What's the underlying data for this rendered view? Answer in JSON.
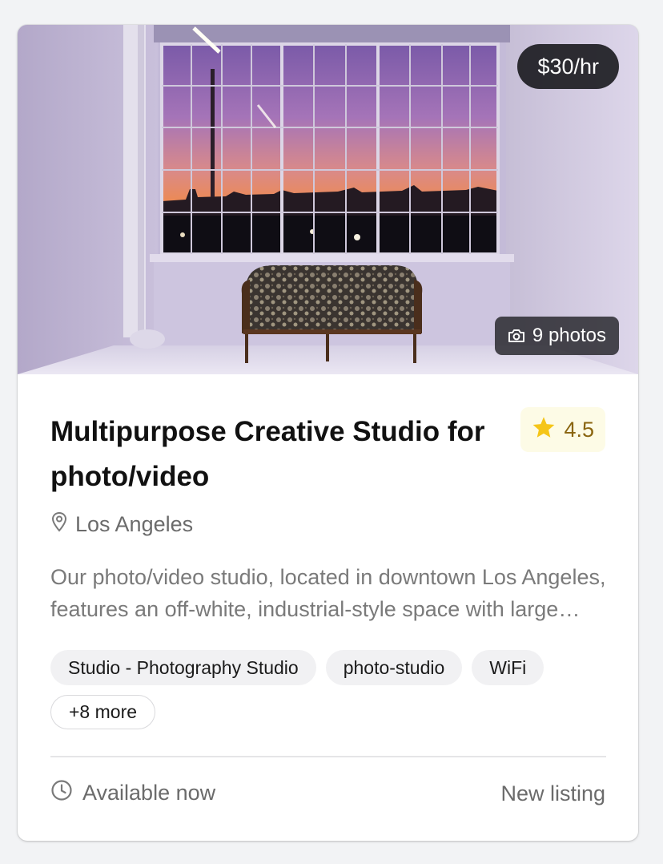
{
  "listing": {
    "price": "$30/hr",
    "photos_count": "9 photos",
    "title": "Multipurpose Creative Studio for photo/video",
    "rating": "4.5",
    "location": "Los Angeles",
    "description": "Our photo/video studio, located in downtown Los Angeles, features an off-white, industrial-style space with large windows, a vintage sofa and natural light throughout the day.",
    "tags": [
      "Studio - Photography Studio",
      "photo-studio",
      "WiFi"
    ],
    "more_tags": "+8 more",
    "availability": "Available now",
    "status": "New listing"
  },
  "icons": {
    "camera": "camera-icon",
    "star": "star-icon",
    "location": "map-pin-icon",
    "clock": "clock-icon"
  },
  "colors": {
    "star": "#f5c518",
    "rating_bg": "#fdfbe6",
    "rating_text": "#8a6510",
    "badge_bg": "#19191e"
  }
}
